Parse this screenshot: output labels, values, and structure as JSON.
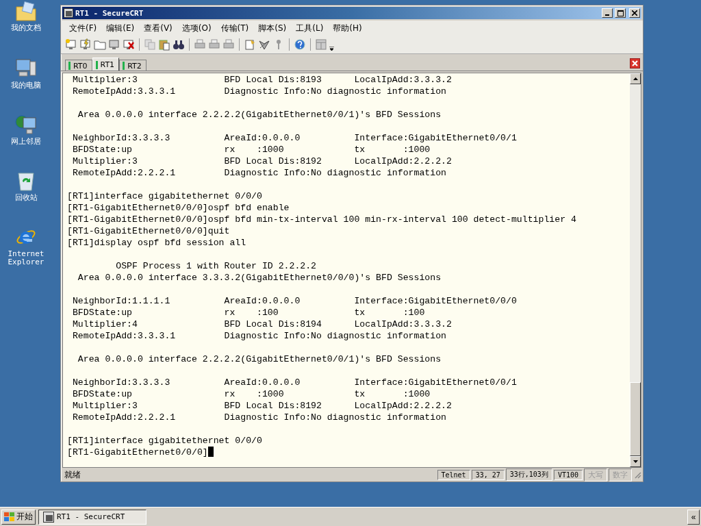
{
  "desktop_icons": [
    {
      "label": "我的文档",
      "kind": "documents"
    },
    {
      "label": "我的电脑",
      "kind": "computer"
    },
    {
      "label": "网上邻居",
      "kind": "network"
    },
    {
      "label": "回收站",
      "kind": "recycle"
    },
    {
      "label": "Internet Explorer",
      "kind": "browser"
    }
  ],
  "window": {
    "title": "RT1 - SecureCRT"
  },
  "menu": [
    "文件(F)",
    "编辑(E)",
    "查看(V)",
    "选项(O)",
    "传输(T)",
    "脚本(S)",
    "工具(L)",
    "帮助(H)"
  ],
  "tabs": [
    {
      "label": "RT0",
      "selected": false
    },
    {
      "label": "RT1",
      "selected": true
    },
    {
      "label": "RT2",
      "selected": false
    }
  ],
  "terminal": {
    "lines": [
      {
        "text": " Multiplier:3                BFD Local Dis:8193      LocalIpAdd:3.3.3.2",
        "blank_before": false
      },
      {
        "text": " RemoteIpAdd:3.3.3.1         Diagnostic Info:No diagnostic information",
        "blank_before": false
      },
      {
        "text": "  Area 0.0.0.0 interface 2.2.2.2(GigabitEthernet0/0/1)'s BFD Sessions",
        "blank_before": true
      },
      {
        "text": " NeighborId:3.3.3.3          AreaId:0.0.0.0          Interface:GigabitEthernet0/0/1",
        "blank_before": true
      },
      {
        "text": " BFDState:up                 rx    :1000             tx       :1000",
        "blank_before": false
      },
      {
        "text": " Multiplier:3                BFD Local Dis:8192      LocalIpAdd:2.2.2.2",
        "blank_before": false
      },
      {
        "text": " RemoteIpAdd:2.2.2.1         Diagnostic Info:No diagnostic information",
        "blank_before": false
      },
      {
        "text": "[RT1]interface gigabitethernet 0/0/0",
        "blank_before": true
      },
      {
        "text": "[RT1-GigabitEthernet0/0/0]ospf bfd enable",
        "blank_before": false
      },
      {
        "text": "[RT1-GigabitEthernet0/0/0]ospf bfd min-tx-interval 100 min-rx-interval 100 detect-multiplier 4",
        "blank_before": false
      },
      {
        "text": "[RT1-GigabitEthernet0/0/0]quit",
        "blank_before": false
      },
      {
        "text": "[RT1]display ospf bfd session all",
        "blank_before": false
      },
      {
        "text": "         OSPF Process 1 with Router ID 2.2.2.2",
        "blank_before": true
      },
      {
        "text": "  Area 0.0.0.0 interface 3.3.3.2(GigabitEthernet0/0/0)'s BFD Sessions",
        "blank_before": false
      },
      {
        "text": " NeighborId:1.1.1.1          AreaId:0.0.0.0          Interface:GigabitEthernet0/0/0",
        "blank_before": true
      },
      {
        "text": " BFDState:up                 rx    :100              tx       :100",
        "blank_before": false
      },
      {
        "text": " Multiplier:4                BFD Local Dis:8194      LocalIpAdd:3.3.3.2",
        "blank_before": false
      },
      {
        "text": " RemoteIpAdd:3.3.3.1         Diagnostic Info:No diagnostic information",
        "blank_before": false
      },
      {
        "text": "  Area 0.0.0.0 interface 2.2.2.2(GigabitEthernet0/0/1)'s BFD Sessions",
        "blank_before": true
      },
      {
        "text": " NeighborId:3.3.3.3          AreaId:0.0.0.0          Interface:GigabitEthernet0/0/1",
        "blank_before": true
      },
      {
        "text": " BFDState:up                 rx    :1000             tx       :1000",
        "blank_before": false
      },
      {
        "text": " Multiplier:3                BFD Local Dis:8192      LocalIpAdd:2.2.2.2",
        "blank_before": false
      },
      {
        "text": " RemoteIpAdd:2.2.2.1         Diagnostic Info:No diagnostic information",
        "blank_before": false
      },
      {
        "text": "[RT1]interface gigabitethernet 0/0/0",
        "blank_before": true
      },
      {
        "text": "[RT1-GigabitEthernet0/0/0]",
        "blank_before": false,
        "cursor": true
      }
    ]
  },
  "status_bar": {
    "message": "就绪",
    "panes": [
      {
        "text": "Telnet",
        "disabled": false
      },
      {
        "text": "33,   27",
        "disabled": false
      },
      {
        "text": "33行,103列",
        "disabled": false
      },
      {
        "text": "VT100",
        "disabled": false
      },
      {
        "text": "大写",
        "disabled": true
      },
      {
        "text": "数字",
        "disabled": true
      }
    ]
  },
  "taskbar": {
    "start": "开始",
    "tasks": [
      {
        "label": "RT1 - SecureCRT",
        "selected": true
      }
    ],
    "tray_button": "«"
  }
}
